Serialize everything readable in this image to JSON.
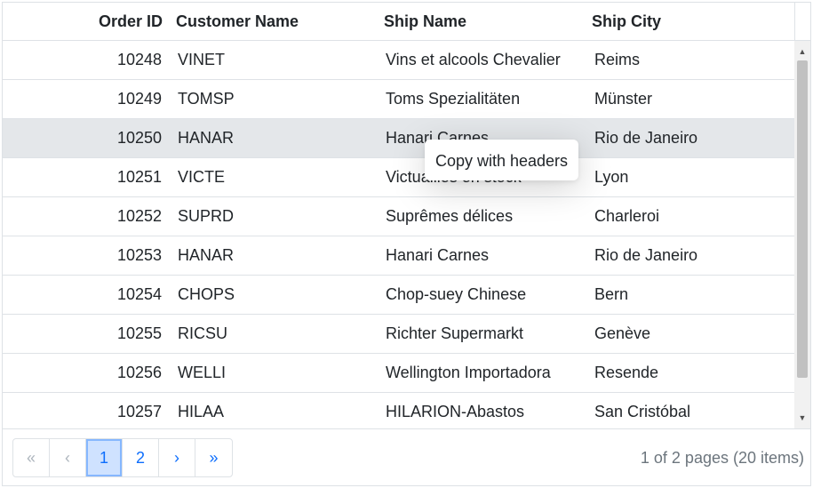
{
  "columns": {
    "order_id": "Order ID",
    "customer_name": "Customer Name",
    "ship_name": "Ship Name",
    "ship_city": "Ship City"
  },
  "rows": [
    {
      "id": "10248",
      "customer": "VINET",
      "ship": "Vins et alcools Chevalier",
      "city": "Reims"
    },
    {
      "id": "10249",
      "customer": "TOMSP",
      "ship": "Toms Spezialitäten",
      "city": "Münster"
    },
    {
      "id": "10250",
      "customer": "HANAR",
      "ship": "Hanari Carnes",
      "city": "Rio de Janeiro"
    },
    {
      "id": "10251",
      "customer": "VICTE",
      "ship": "Victuailles en stock",
      "city": "Lyon"
    },
    {
      "id": "10252",
      "customer": "SUPRD",
      "ship": "Suprêmes délices",
      "city": "Charleroi"
    },
    {
      "id": "10253",
      "customer": "HANAR",
      "ship": "Hanari Carnes",
      "city": "Rio de Janeiro"
    },
    {
      "id": "10254",
      "customer": "CHOPS",
      "ship": "Chop-suey Chinese",
      "city": "Bern"
    },
    {
      "id": "10255",
      "customer": "RICSU",
      "ship": "Richter Supermarkt",
      "city": "Genève"
    },
    {
      "id": "10256",
      "customer": "WELLI",
      "ship": "Wellington Importadora",
      "city": "Resende"
    },
    {
      "id": "10257",
      "customer": "HILAA",
      "ship": "HILARION-Abastos",
      "city": "San Cristóbal"
    }
  ],
  "selected_row_index": 2,
  "context_menu": {
    "copy_with_headers": "Copy with headers"
  },
  "pager": {
    "first": "«",
    "prev": "‹",
    "page1": "1",
    "page2": "2",
    "next": "›",
    "last": "»",
    "info": "1 of 2 pages (20 items)"
  },
  "scrollbar": {
    "up": "▲",
    "down": "▼"
  },
  "colors": {
    "link": "#0d6efd",
    "selected_row": "#e4e7ea",
    "active_page_bg": "#cfe2ff"
  }
}
